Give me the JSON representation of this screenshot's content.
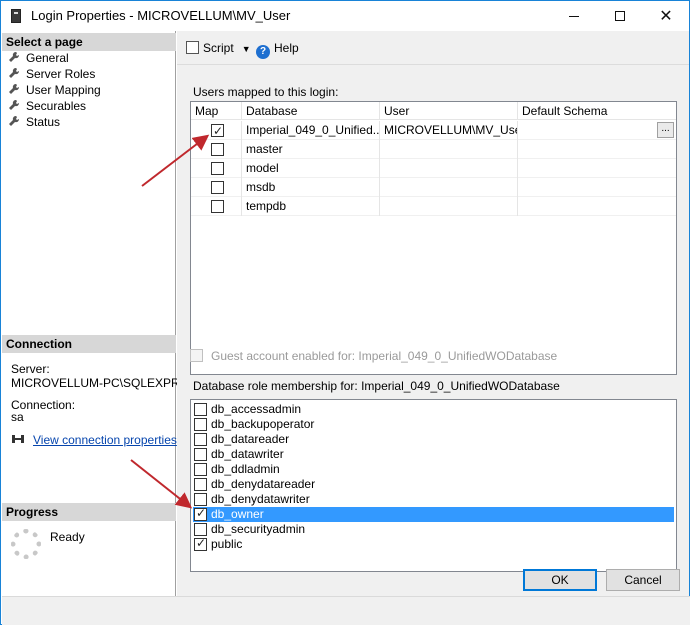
{
  "window": {
    "title": "Login Properties -  MICROVELLUM\\MV_User",
    "minimize_glyph": "",
    "maximize_glyph": "",
    "close_glyph": "✕"
  },
  "left": {
    "select_page_header": "Select a page",
    "pages": [
      {
        "label": "General",
        "icon": "wrench-icon"
      },
      {
        "label": "Server Roles",
        "icon": "wrench-icon"
      },
      {
        "label": "User Mapping",
        "icon": "wrench-icon"
      },
      {
        "label": "Securables",
        "icon": "wrench-icon"
      },
      {
        "label": "Status",
        "icon": "wrench-icon"
      }
    ],
    "connection_header": "Connection",
    "server_label": "Server:",
    "server_value": "MICROVELLUM-PC\\SQLEXPRESS",
    "connection_label": "Connection:",
    "connection_value": "sa",
    "view_connection_link": "View connection properties",
    "progress_header": "Progress",
    "progress_status": "Ready"
  },
  "toolbar": {
    "script_label": "Script",
    "help_label": "Help"
  },
  "mapping": {
    "label": "Users mapped to this login:",
    "columns": [
      "Map",
      "Database",
      "User",
      "Default Schema"
    ],
    "rows": [
      {
        "map": true,
        "database": "Imperial_049_0_Unified...",
        "user": "MICROVELLUM\\MV_User",
        "schema": "",
        "ellipsis": "..."
      },
      {
        "map": false,
        "database": "master",
        "user": "",
        "schema": ""
      },
      {
        "map": false,
        "database": "model",
        "user": "",
        "schema": ""
      },
      {
        "map": false,
        "database": "msdb",
        "user": "",
        "schema": ""
      },
      {
        "map": false,
        "database": "tempdb",
        "user": "",
        "schema": ""
      }
    ]
  },
  "guest": {
    "label": "Guest account enabled for: Imperial_049_0_UnifiedWODatabase",
    "checked": false
  },
  "roles": {
    "label": "Database role membership for: Imperial_049_0_UnifiedWODatabase",
    "items": [
      {
        "name": "db_accessadmin",
        "checked": false,
        "selected": false
      },
      {
        "name": "db_backupoperator",
        "checked": false,
        "selected": false
      },
      {
        "name": "db_datareader",
        "checked": false,
        "selected": false
      },
      {
        "name": "db_datawriter",
        "checked": false,
        "selected": false
      },
      {
        "name": "db_ddladmin",
        "checked": false,
        "selected": false
      },
      {
        "name": "db_denydatareader",
        "checked": false,
        "selected": false
      },
      {
        "name": "db_denydatawriter",
        "checked": false,
        "selected": false
      },
      {
        "name": "db_owner",
        "checked": true,
        "selected": true
      },
      {
        "name": "db_securityadmin",
        "checked": false,
        "selected": false
      },
      {
        "name": "public",
        "checked": true,
        "selected": false
      }
    ]
  },
  "buttons": {
    "ok": "OK",
    "cancel": "Cancel"
  },
  "colors": {
    "selection": "#3399ff",
    "arrow": "#c0282d",
    "link": "#0645ad"
  }
}
